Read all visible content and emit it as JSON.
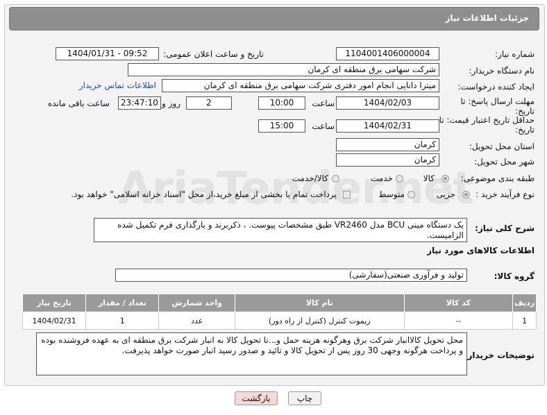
{
  "header": {
    "title": "جزئیات اطلاعات نیاز"
  },
  "fields": {
    "need_number_label": "شماره نیاز:",
    "need_number": "1104001406000004",
    "announce_label": "تاریخ و ساعت اعلان عمومی:",
    "announce_value": "1404/01/31 - 09:52",
    "buyer_label": "نام دستگاه خریدار:",
    "buyer_value": "شرکت سهامی برق منطقه ای کرمان",
    "creator_label": "ایجاد کننده درخواست:",
    "creator_value": "میترا دانایی انجام امور دفتری شرکت سهامی برق منطقه ای کرمان",
    "contact_link": "اطلاعات تماس خریدار",
    "deadline_label": "مهلت ارسال پاسخ: تا تاریخ:",
    "deadline_date": "1404/02/03",
    "time_label": "ساعت",
    "deadline_time": "10:00",
    "days_value": "2",
    "days_label": "روز و",
    "remaining_value": "23:47:10",
    "remaining_label": "ساعت باقی مانده",
    "validity_label": "حداقل تاریخ اعتبار قیمت: تا تاریخ:",
    "validity_date": "1404/02/31",
    "validity_time": "15:00",
    "province_label": "استان محل تحویل:",
    "province_value": "کرمان",
    "city_label": "شهر محل تحویل:",
    "city_value": "کرمان",
    "category_label": "طبقه بندی موضوعی:",
    "category_options": [
      "کالا",
      "خدمت",
      "کالا/خدمت"
    ],
    "process_label": "نوع فرآیند خرید :",
    "process_options": [
      "جزیی",
      "متوسط"
    ],
    "payment_note": "پرداخت تمام یا بخشی از مبلغ خرید،از محل \"اسناد خزانه اسلامی\" خواهد بود."
  },
  "description": {
    "label": "شرح کلی نیاز:",
    "text": "یک دستگاه  مینی BCU مدل VR2460 طبق مشخصات پیوست. ، ذکربرند و بارگذاری فرم تکمیل شده الزامیست."
  },
  "goods_info": {
    "heading": "اطلاعات کالاهای مورد نیاز",
    "group_label": "گروه کالا:",
    "group_value": "تولید و فرآوری صنعتی(سفارشی)"
  },
  "table": {
    "headers": [
      "ردیف",
      "کد کالا",
      "نام کالا",
      "واحد شمارش",
      "تعداد / مقدار",
      "تاریخ نیاز"
    ],
    "rows": [
      [
        "1",
        "--",
        "ریموت کنترل (کنترل از راه دور)",
        "عدد",
        "1",
        "1404/02/31"
      ]
    ]
  },
  "buyer_notes": {
    "label": "توضیحات خریدار:",
    "text": "محل تحویل کالاانبار شرکت برق وهرگونه هزینه حمل و...تا تحویل کالا به انبار شرکت برق منطقه ای به عهده فروشنده بوده و پرداخت هرگونه وجهی 30 روز پس از تحویل کالا و تائید و صدور رسید انبار صورت خواهد پذیرفت."
  },
  "buttons": {
    "print": "چاپ",
    "back": "بازگشت"
  },
  "watermark": "AriaTender.net",
  "colors": {
    "title_bar": "#8e8e8e",
    "table_header": "#9a9a9a",
    "link": "#1a4fb5",
    "back_button": "#f7d7d7"
  }
}
